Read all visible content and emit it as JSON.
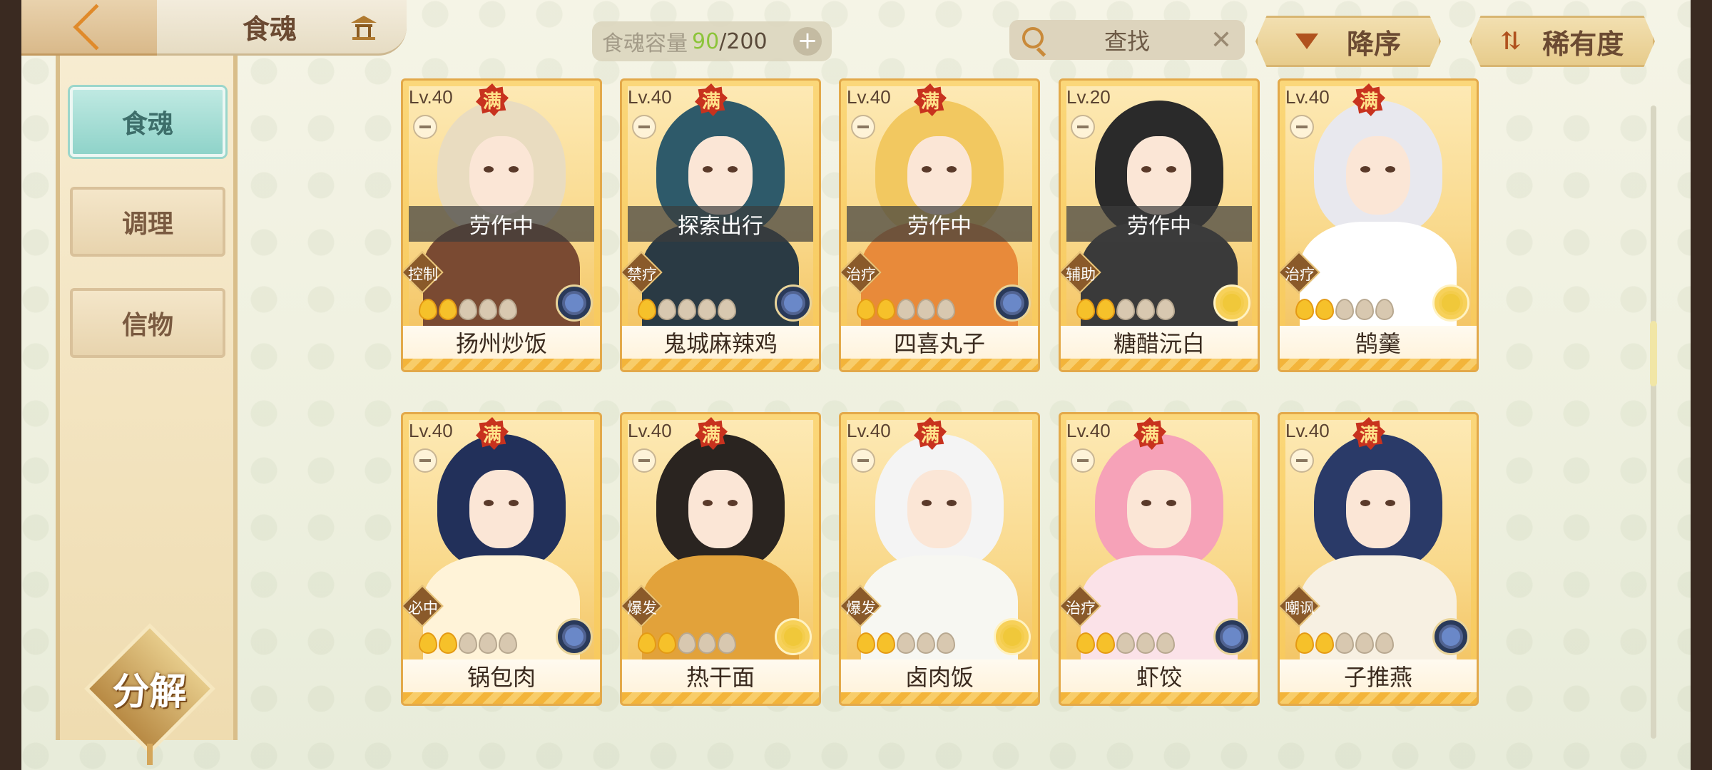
{
  "header": {
    "title": "食魂",
    "capacity_label": "食魂容量",
    "capacity_current": "90",
    "capacity_max": "/200",
    "capacity_add": "+",
    "search_placeholder": "查找",
    "search_clear": "✕",
    "sort_order_label": "降序",
    "sort_key_label": "稀有度"
  },
  "sidebar": {
    "tabs": [
      {
        "label": "食魂",
        "active": true
      },
      {
        "label": "调理",
        "active": false
      },
      {
        "label": "信物",
        "active": false
      }
    ],
    "decompose_label": "分解"
  },
  "cards": [
    {
      "level": "Lv.40",
      "full": "满",
      "status": "劳作中",
      "role": "控制",
      "name": "扬州炒饭",
      "stars_lit": 2,
      "elem": "blue",
      "hair": "#e9dcc0",
      "body": "#7a4a32"
    },
    {
      "level": "Lv.40",
      "full": "满",
      "status": "探索出行",
      "role": "禁疗",
      "name": "鬼城麻辣鸡",
      "stars_lit": 1,
      "elem": "blue",
      "hair": "#2e5a6a",
      "body": "#2a3a44"
    },
    {
      "level": "Lv.40",
      "full": "满",
      "status": "劳作中",
      "role": "治疗",
      "name": "四喜丸子",
      "stars_lit": 2,
      "elem": "blue",
      "hair": "#f2c860",
      "body": "#e88a3a"
    },
    {
      "level": "Lv.20",
      "full": "",
      "status": "劳作中",
      "role": "辅助",
      "name": "糖醋沅白",
      "stars_lit": 2,
      "elem": "gold",
      "hair": "#2a2a2a",
      "body": "#3a3a3a"
    },
    {
      "level": "Lv.40",
      "full": "满",
      "status": "",
      "role": "治疗",
      "name": "鹄羹",
      "stars_lit": 2,
      "elem": "gold",
      "hair": "#e8e8ee",
      "body": "#ffffff"
    },
    {
      "level": "Lv.40",
      "full": "满",
      "status": "",
      "role": "必中",
      "name": "锅包肉",
      "stars_lit": 2,
      "elem": "blue",
      "hair": "#22305a",
      "body": "#fff3d8"
    },
    {
      "level": "Lv.40",
      "full": "满",
      "status": "",
      "role": "爆发",
      "name": "热干面",
      "stars_lit": 2,
      "elem": "gold",
      "hair": "#2a2420",
      "body": "#e2a23a"
    },
    {
      "level": "Lv.40",
      "full": "满",
      "status": "",
      "role": "爆发",
      "name": "卤肉饭",
      "stars_lit": 2,
      "elem": "gold",
      "hair": "#f4f4f4",
      "body": "#f7f7f2"
    },
    {
      "level": "Lv.40",
      "full": "满",
      "status": "",
      "role": "治疗",
      "name": "虾饺",
      "stars_lit": 2,
      "elem": "blue",
      "hair": "#f6a2b8",
      "body": "#fbe2e8"
    },
    {
      "level": "Lv.40",
      "full": "满",
      "status": "",
      "role": "嘲讽",
      "name": "子推燕",
      "stars_lit": 2,
      "elem": "blue",
      "hair": "#2a3a68",
      "body": "#f7f0e2"
    }
  ],
  "colors": {
    "accent_teal": "#8fd3c9",
    "card_gold": "#f7c85a",
    "capacity_green": "#8cc43a",
    "full_badge_red": "#c8321e"
  },
  "icons": [
    "back-arrow-icon",
    "pavilion-icon",
    "plus-icon",
    "search-icon",
    "clear-icon",
    "sort-desc-icon",
    "swap-icon",
    "lock-icon",
    "element-icon"
  ]
}
